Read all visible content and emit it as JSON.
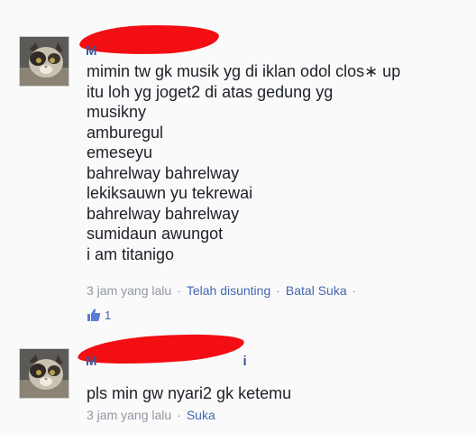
{
  "comments": [
    {
      "author_initial": "M",
      "lines": [
        "mimin tw gk musik yg di iklan odol clos∗ up",
        "itu loh yg joget2 di atas gedung yg",
        "musikny",
        "amburegul",
        "emeseyu",
        "bahrelway bahrelway",
        "lekiksauwn yu tekrewai",
        "bahrelway bahrelway",
        "sumidaun awungot",
        "i am titanigo"
      ],
      "time": "3 jam yang lalu",
      "edited": "Telah disunting",
      "action": "Batal Suka",
      "like_count": "1"
    },
    {
      "author_initial": "M",
      "author_trailing": "i",
      "lines": [
        "pls min gw nyari2 gk ketemu"
      ],
      "time": "3 jam yang lalu",
      "action": "Suka"
    }
  ],
  "colors": {
    "link": "#4267b2",
    "meta": "#9197a3",
    "redaction": "#f20e12"
  },
  "icons": [
    "cat-avatar",
    "thumbs-up-icon"
  ]
}
